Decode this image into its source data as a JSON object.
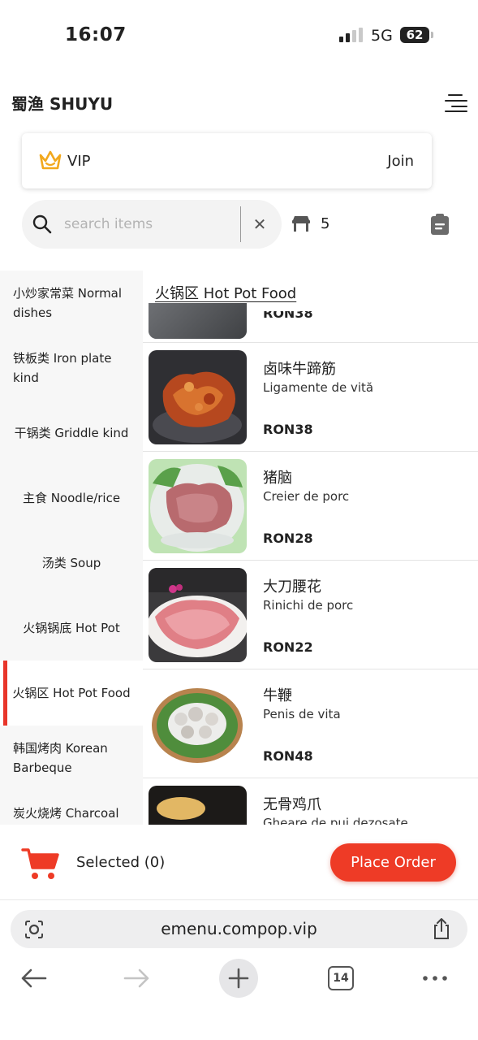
{
  "status_bar": {
    "time": "16:07",
    "network": "5G",
    "battery": "62"
  },
  "header": {
    "title": "蜀渔 SHUYU"
  },
  "vip": {
    "label": "VIP",
    "join": "Join"
  },
  "search": {
    "placeholder": "search items",
    "value": ""
  },
  "table": {
    "number": "5"
  },
  "sidebar": {
    "items": [
      {
        "label": "小炒家常菜 Normal dishes"
      },
      {
        "label": "铁板类 Iron plate kind"
      },
      {
        "label": "干锅类 Griddle kind"
      },
      {
        "label": "主食 Noodle/rice"
      },
      {
        "label": "汤类 Soup"
      },
      {
        "label": "火锅锅底 Hot Pot"
      },
      {
        "label": "火锅区 Hot Pot Food"
      },
      {
        "label": "韩国烤肉 Korean Barbeque"
      },
      {
        "label": "炭火烧烤 Charcoal"
      }
    ]
  },
  "menu": {
    "section_title": "火锅区 Hot Pot Food",
    "partial_price": "RON38",
    "dishes": [
      {
        "name": "卤味牛蹄筋",
        "subtitle": "Ligamente de vită",
        "price": "RON38"
      },
      {
        "name": "猪脑",
        "subtitle": "Creier de porc",
        "price": "RON28"
      },
      {
        "name": "大刀腰花",
        "subtitle": "Rinichi de porc",
        "price": "RON22"
      },
      {
        "name": "牛鞭",
        "subtitle": "Penis de vita",
        "price": "RON48"
      },
      {
        "name": "无骨鸡爪",
        "subtitle": "Gheare de pui dezosate",
        "price": ""
      }
    ]
  },
  "order_bar": {
    "selected": "Selected (0)",
    "place_order": "Place Order"
  },
  "browser": {
    "url": "emenu.compop.vip",
    "tab_count": "14"
  },
  "colors": {
    "accent": "#ee3b26",
    "active_bar": "#e8352a",
    "crown": "#f2a81d"
  }
}
